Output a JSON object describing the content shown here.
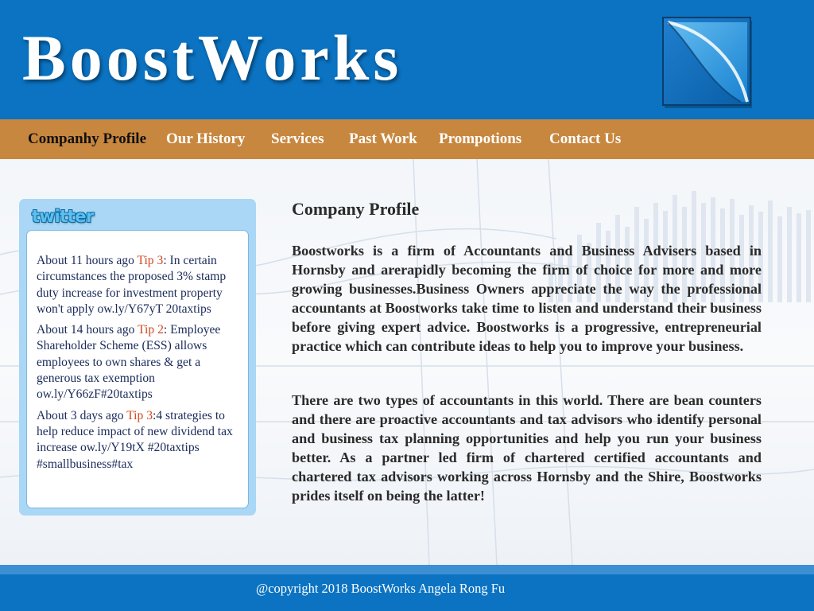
{
  "header": {
    "logo_text": "BoostWorks",
    "logo_mark_icon": "leaf-square-icon",
    "brand_color": "#0b73c2"
  },
  "nav": {
    "accent_color": "#c8873f",
    "items": [
      {
        "label": "Companhy Profile",
        "active": true
      },
      {
        "label": "Our History"
      },
      {
        "label": "Services"
      },
      {
        "label": "Past Work"
      },
      {
        "label": "Prompotions"
      },
      {
        "label": "Contact Us"
      }
    ]
  },
  "twitter": {
    "logo_text": "twitter",
    "tweets": [
      {
        "time": "About 11 hours ago",
        "tip": "Tip 3",
        "text": ": In certain circumstances the proposed 3% stamp duty increase for investment property won't apply ow.ly/Y67yT 20taxtips"
      },
      {
        "time": "About 14 hours ago",
        "tip": "Tip 2",
        "text": ": Employee Shareholder Scheme (ESS) allows employees to own shares & get a generous tax exemption ow.ly/Y66zF#20taxtips"
      },
      {
        "time": "About 3 days ago",
        "tip": "Tip 3",
        "text": ":4 strategies to help reduce impact of new dividend tax increase ow.ly/Y19tX #20taxtips #smallbusiness#tax"
      }
    ]
  },
  "main": {
    "title": "Company Profile",
    "paragraphs": [
      "Boostworks is a firm of Accountants and Business Advisers based in Hornsby and arerapidly becoming the firm of choice for more and more growing businesses.Business Owners appreciate the way the professional accountants at Boostworks take time to listen and understand their business before giving expert advice. Boostworks is a progressive, entrepreneurial practice which can contribute ideas to help you to improve your business.",
      "There are two types of accountants in this world. There are bean counters and there are proactive accountants and tax advisors who identify personal and business tax planning opportunities and help you run your business better. As a partner led firm of chartered certified accountants and chartered tax advisors working across Hornsby and the Shire, Boostworks prides itself on being the latter!"
    ]
  },
  "footer": {
    "copyright": "@copyright 2018 BoostWorks Angela Rong Fu"
  }
}
